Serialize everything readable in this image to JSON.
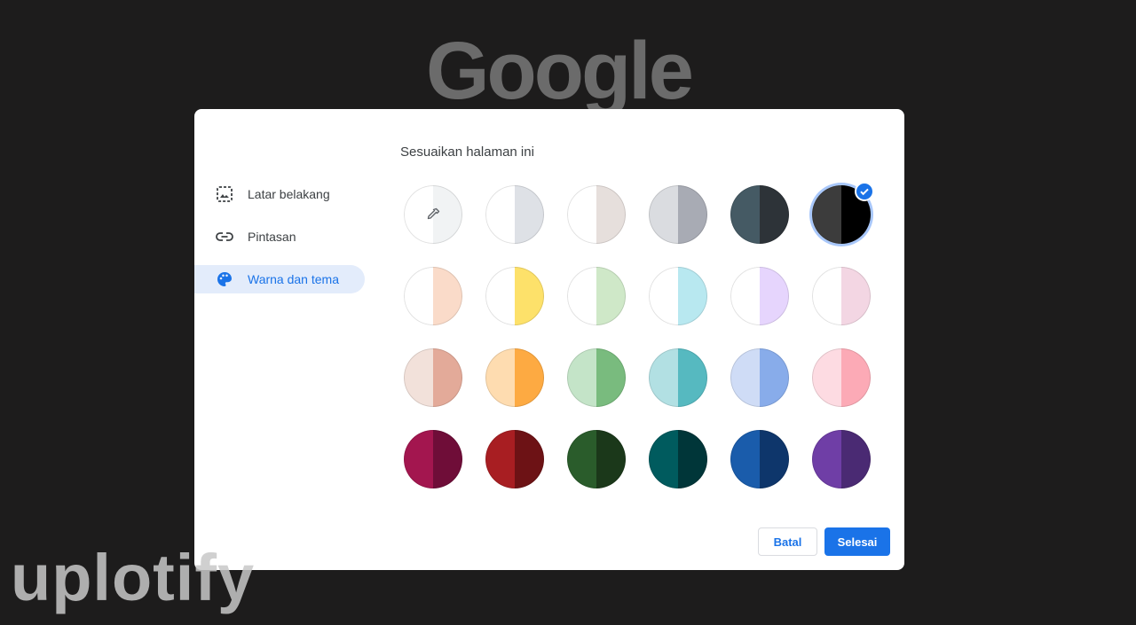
{
  "logo_text": "Google",
  "dialog": {
    "title": "Sesuaikan halaman ini",
    "nav": [
      {
        "label": "Latar belakang",
        "icon": "image-icon",
        "active": false
      },
      {
        "label": "Pintasan",
        "icon": "link-icon",
        "active": false
      },
      {
        "label": "Warna dan tema",
        "icon": "palette-icon",
        "active": true
      }
    ],
    "cancel_label": "Batal",
    "done_label": "Selesai"
  },
  "swatches": [
    {
      "left": "#ffffff",
      "right": "#f1f3f4",
      "custom": true
    },
    {
      "left": "#ffffff",
      "right": "#dee1e6"
    },
    {
      "left": "#ffffff",
      "right": "#e6dfdc"
    },
    {
      "left": "#dadce0",
      "right": "#a8abb4"
    },
    {
      "left": "#455a64",
      "right": "#2d3338"
    },
    {
      "left": "#3c3c3c",
      "right": "#000000",
      "selected": true
    },
    {
      "left": "#ffffff",
      "right": "#fadbc9"
    },
    {
      "left": "#ffffff",
      "right": "#fde16a"
    },
    {
      "left": "#ffffff",
      "right": "#cfe8c8"
    },
    {
      "left": "#ffffff",
      "right": "#b8e8f0"
    },
    {
      "left": "#ffffff",
      "right": "#e6d5fd"
    },
    {
      "left": "#ffffff",
      "right": "#f3d6e3"
    },
    {
      "left": "#f2e1da",
      "right": "#e3aa99"
    },
    {
      "left": "#fedcb0",
      "right": "#fdaa42"
    },
    {
      "left": "#c4e4c8",
      "right": "#79bb7e"
    },
    {
      "left": "#b2e0e3",
      "right": "#56b9c0"
    },
    {
      "left": "#cfdcf6",
      "right": "#88acea"
    },
    {
      "left": "#fddbe2",
      "right": "#fcaab6"
    },
    {
      "left": "#a3164f",
      "right": "#6f0d38"
    },
    {
      "left": "#a81e22",
      "right": "#6d1215"
    },
    {
      "left": "#2a5c2b",
      "right": "#1b381a"
    },
    {
      "left": "#005b5e",
      "right": "#003639"
    },
    {
      "left": "#1a5cab",
      "right": "#0e366b"
    },
    {
      "left": "#6f3ea6",
      "right": "#4a2a73"
    }
  ],
  "accent_color": "#1a73e8",
  "watermark": "uplotify"
}
